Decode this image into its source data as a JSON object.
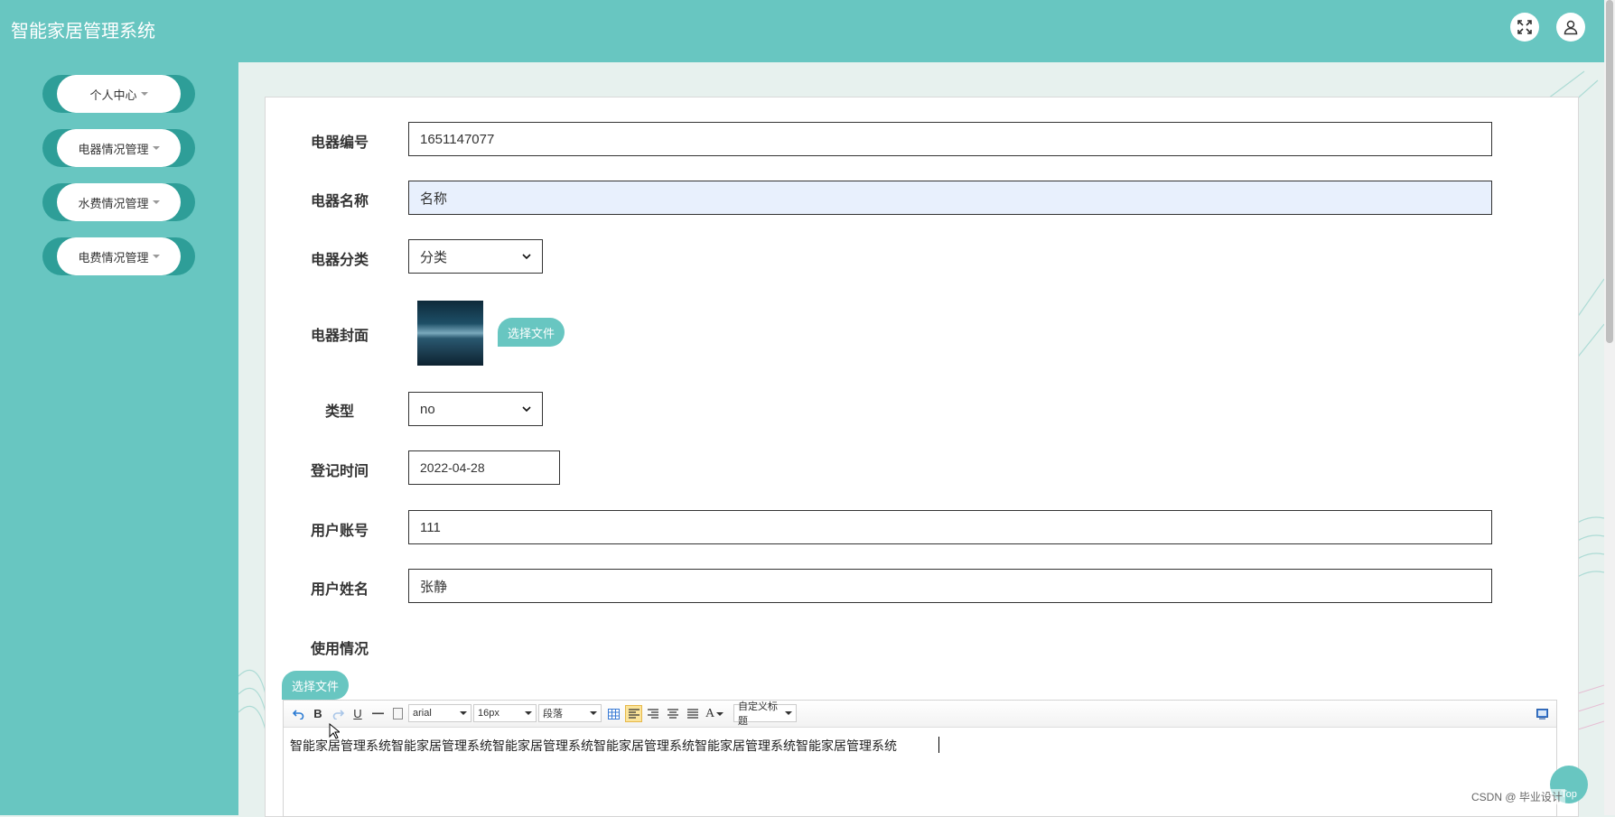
{
  "header": {
    "app_title": "智能家居管理系统"
  },
  "sidebar": {
    "items": [
      {
        "label": "个人中心"
      },
      {
        "label": "电器情况管理"
      },
      {
        "label": "水费情况管理"
      },
      {
        "label": "电费情况管理"
      }
    ]
  },
  "form": {
    "appliance_no": {
      "label": "电器编号",
      "value": "1651147077"
    },
    "appliance_name": {
      "label": "电器名称",
      "value": "名称"
    },
    "appliance_category": {
      "label": "电器分类",
      "value": "分类"
    },
    "appliance_cover": {
      "label": "电器封面",
      "button": "选择文件"
    },
    "type": {
      "label": "类型",
      "value": "no"
    },
    "register_time": {
      "label": "登记时间",
      "value": "2022-04-28"
    },
    "user_account": {
      "label": "用户账号",
      "value": "111"
    },
    "user_name": {
      "label": "用户姓名",
      "value": "张静"
    },
    "usage": {
      "label": "使用情况",
      "button": "选择文件"
    }
  },
  "editor": {
    "font_family": "arial",
    "font_size": "16px",
    "paragraph": "段落",
    "custom_heading": "自定义标题",
    "content": "智能家居管理系统智能家居管理系统智能家居管理系统智能家居管理系统智能家居管理系统智能家居管理系统"
  },
  "back_to_top": "Top",
  "watermark": "CSDN @ 毕业设计"
}
